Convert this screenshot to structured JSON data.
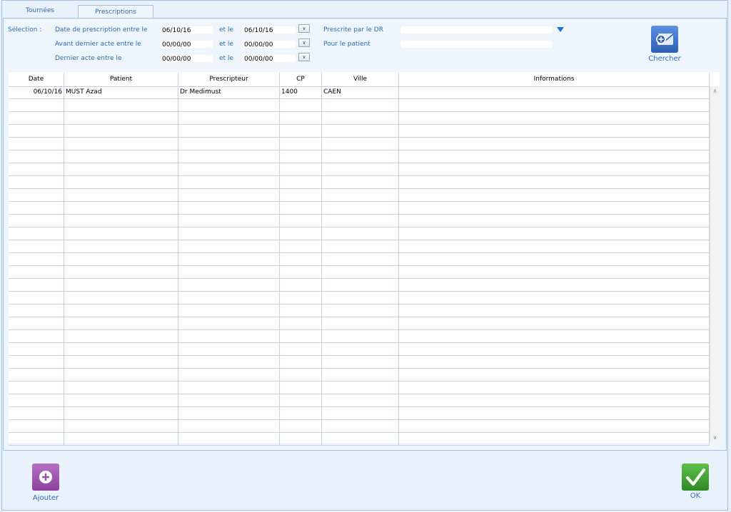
{
  "tabs": [
    {
      "label": "Tournées",
      "active": false
    },
    {
      "label": "Prescriptions",
      "active": true
    }
  ],
  "filters": {
    "selection_label": "Sélection :",
    "between_label": "et le",
    "rows": [
      {
        "label": "Date de prescription entre le",
        "from": "06/10/16",
        "to": "06/10/16"
      },
      {
        "label": "Avant dernier acte entre le",
        "from": "00/00/00",
        "to": "00/00/00"
      },
      {
        "label": "Dernier acte entre le",
        "from": "00/00/00",
        "to": "00/00/00"
      }
    ],
    "prescrite_label": "Prescrite par le DR",
    "prescrite_value": "",
    "patient_label": "Pour le patient",
    "patient_value": ""
  },
  "search_button": {
    "label": "Chercher",
    "icon": "search-document-icon",
    "color": "#3a6fc4"
  },
  "table": {
    "columns": [
      "Date",
      "Patient",
      "Prescripteur",
      "CP",
      "Ville",
      "Informations"
    ],
    "rows": [
      [
        "06/10/16",
        "MUST Azad",
        "Dr Medimust",
        "1400",
        "CAEN",
        ""
      ]
    ]
  },
  "add_button": {
    "label": "Ajouter",
    "icon": "plus-icon",
    "color": "#9b4fa6"
  },
  "ok_button": {
    "label": "OK",
    "icon": "checkmark-icon",
    "color": "#3e9e32"
  }
}
